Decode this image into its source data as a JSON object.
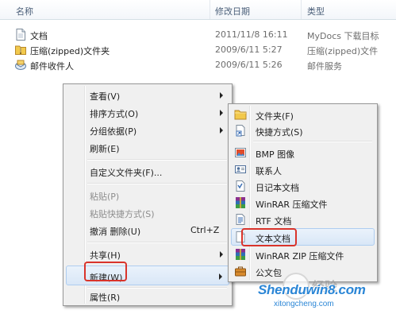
{
  "explorer": {
    "columns": {
      "name": "名称",
      "date": "修改日期",
      "type": "类型"
    },
    "files": [
      {
        "name": "文档",
        "date": "2011/11/8 16:11",
        "type": "MyDocs 下载目标",
        "icon": "document-icon"
      },
      {
        "name": "压缩(zipped)文件夹",
        "date": "2009/6/11 5:27",
        "type": "压缩(zipped)文件",
        "icon": "zip-folder-icon"
      },
      {
        "name": "邮件收件人",
        "date": "2009/6/11 5:26",
        "type": "邮件服务",
        "icon": "mail-recipient-icon"
      }
    ]
  },
  "context_menu": {
    "items": [
      {
        "label": "查看(V)",
        "submenu": true
      },
      {
        "label": "排序方式(O)",
        "submenu": true
      },
      {
        "label": "分组依据(P)",
        "submenu": true
      },
      {
        "label": "刷新(E)"
      },
      {
        "label": "自定义文件夹(F)..."
      },
      {
        "label": "粘贴(P)",
        "disabled": true
      },
      {
        "label": "粘贴快捷方式(S)",
        "disabled": true
      },
      {
        "label": "撤消 删除(U)",
        "shortcut": "Ctrl+Z"
      },
      {
        "label": "共享(H)",
        "submenu": true
      },
      {
        "label": "新建(W)",
        "submenu": true,
        "highlighted": true
      },
      {
        "label": "属性(R)"
      }
    ]
  },
  "new_submenu": {
    "items": [
      {
        "label": "文件夹(F)",
        "icon": "folder-icon"
      },
      {
        "label": "快捷方式(S)",
        "icon": "shortcut-icon"
      },
      {
        "label": "BMP 图像",
        "icon": "bmp-image-icon"
      },
      {
        "label": "联系人",
        "icon": "contact-icon"
      },
      {
        "label": "日记本文档",
        "icon": "journal-icon"
      },
      {
        "label": "WinRAR 压缩文件",
        "icon": "winrar-icon"
      },
      {
        "label": "RTF 文档",
        "icon": "rtf-icon"
      },
      {
        "label": "文本文档",
        "icon": "text-document-icon",
        "highlighted": true
      },
      {
        "label": "WinRAR ZIP 压缩文件",
        "icon": "winrar-zip-icon"
      },
      {
        "label": "公文包",
        "icon": "briefcase-icon"
      }
    ]
  },
  "watermark": {
    "site": "Shenduwin8.com",
    "sub": "xitongcheng.com",
    "text": "经验"
  },
  "colors": {
    "highlight_border": "#d9342b",
    "menu_bg": "#f0f0f0",
    "hover_border": "#aecdf0",
    "link_blue": "#2b86d6"
  }
}
